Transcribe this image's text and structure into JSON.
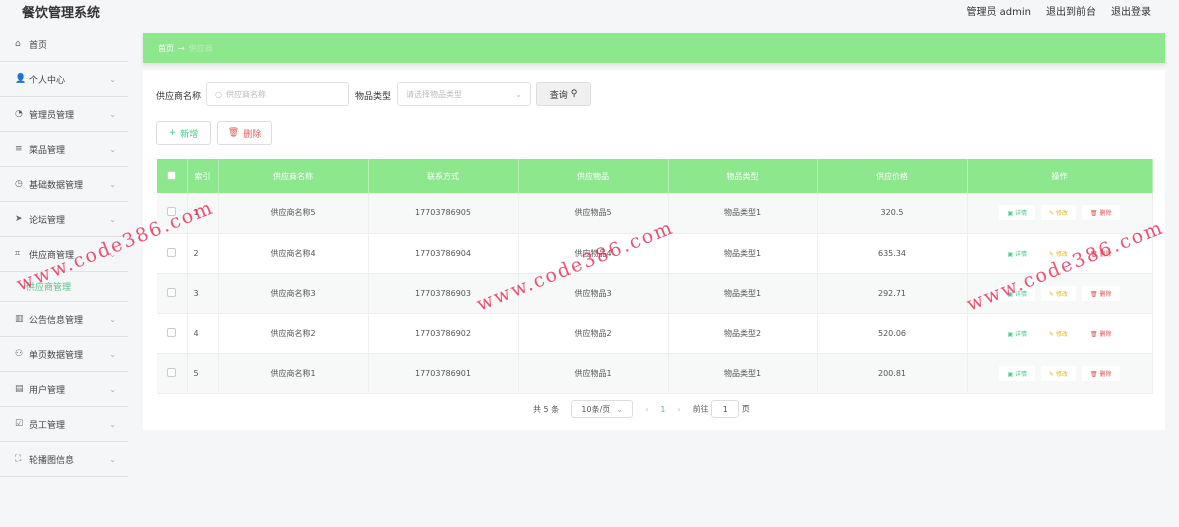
{
  "app_title": "餐饮管理系统",
  "top_links": [
    "管理员 admin",
    "退出到前台",
    "退出登录"
  ],
  "sidebar": [
    {
      "label": "首页",
      "icon": "home-icon",
      "glyph": "⌂",
      "chev": false
    },
    {
      "label": "个人中心",
      "icon": "user-icon",
      "glyph": "👤",
      "chev": true
    },
    {
      "label": "管理员管理",
      "icon": "admin-icon",
      "glyph": "◔",
      "chev": true
    },
    {
      "label": "菜品管理",
      "icon": "menu-icon",
      "glyph": "≡",
      "chev": true
    },
    {
      "label": "基础数据管理",
      "icon": "compass-icon",
      "glyph": "◷",
      "chev": true
    },
    {
      "label": "论坛管理",
      "icon": "send-icon",
      "glyph": "➤",
      "chev": true
    },
    {
      "label": "供应商管理",
      "icon": "crop-icon",
      "glyph": "⌗",
      "chev": true,
      "sub": "供应商管理"
    },
    {
      "label": "公告信息管理",
      "icon": "chart-icon",
      "glyph": "▥",
      "chev": true
    },
    {
      "label": "单页数据管理",
      "icon": "users-icon",
      "glyph": "⚇",
      "chev": true
    },
    {
      "label": "用户管理",
      "icon": "user-card-icon",
      "glyph": "▤",
      "chev": true
    },
    {
      "label": "员工管理",
      "icon": "check-icon",
      "glyph": "☑",
      "chev": true
    },
    {
      "label": "轮播图信息",
      "icon": "fullscreen-icon",
      "glyph": "⛶",
      "chev": true
    }
  ],
  "breadcrumb": {
    "home": "首页",
    "arrow": "→",
    "current": "供应商"
  },
  "search": {
    "name_label": "供应商名称",
    "name_placeholder": "供应商名称",
    "type_label": "物品类型",
    "type_placeholder": "请选择物品类型",
    "query": "查询"
  },
  "actions": {
    "add": "新增",
    "delete": "删除"
  },
  "table": {
    "headers": [
      "索引",
      "供应商名称",
      "联系方式",
      "供应物品",
      "物品类型",
      "供应价格",
      "操作"
    ],
    "rows": [
      [
        "1",
        "供应商名称5",
        "17703786905",
        "供应物品5",
        "物品类型1",
        "320.5"
      ],
      [
        "2",
        "供应商名称4",
        "17703786904",
        "供应物品4",
        "物品类型1",
        "635.34"
      ],
      [
        "3",
        "供应商名称3",
        "17703786903",
        "供应物品3",
        "物品类型1",
        "292.71"
      ],
      [
        "4",
        "供应商名称2",
        "17703786902",
        "供应物品2",
        "物品类型2",
        "520.06"
      ],
      [
        "5",
        "供应商名称1",
        "17703786901",
        "供应物品1",
        "物品类型1",
        "200.81"
      ]
    ],
    "row_actions": [
      "详情",
      "修改",
      "删除"
    ]
  },
  "pagination": {
    "total": "共 5 条",
    "page_size": "10条/页",
    "current": "1",
    "goto": "前往",
    "goto_value": "1",
    "page_unit": "页"
  },
  "watermark": "www.code386.com",
  "colors": {
    "accent": "#8de88d",
    "detail": "#4cc98a",
    "edit": "#e6b422",
    "delete": "#d9534f"
  }
}
